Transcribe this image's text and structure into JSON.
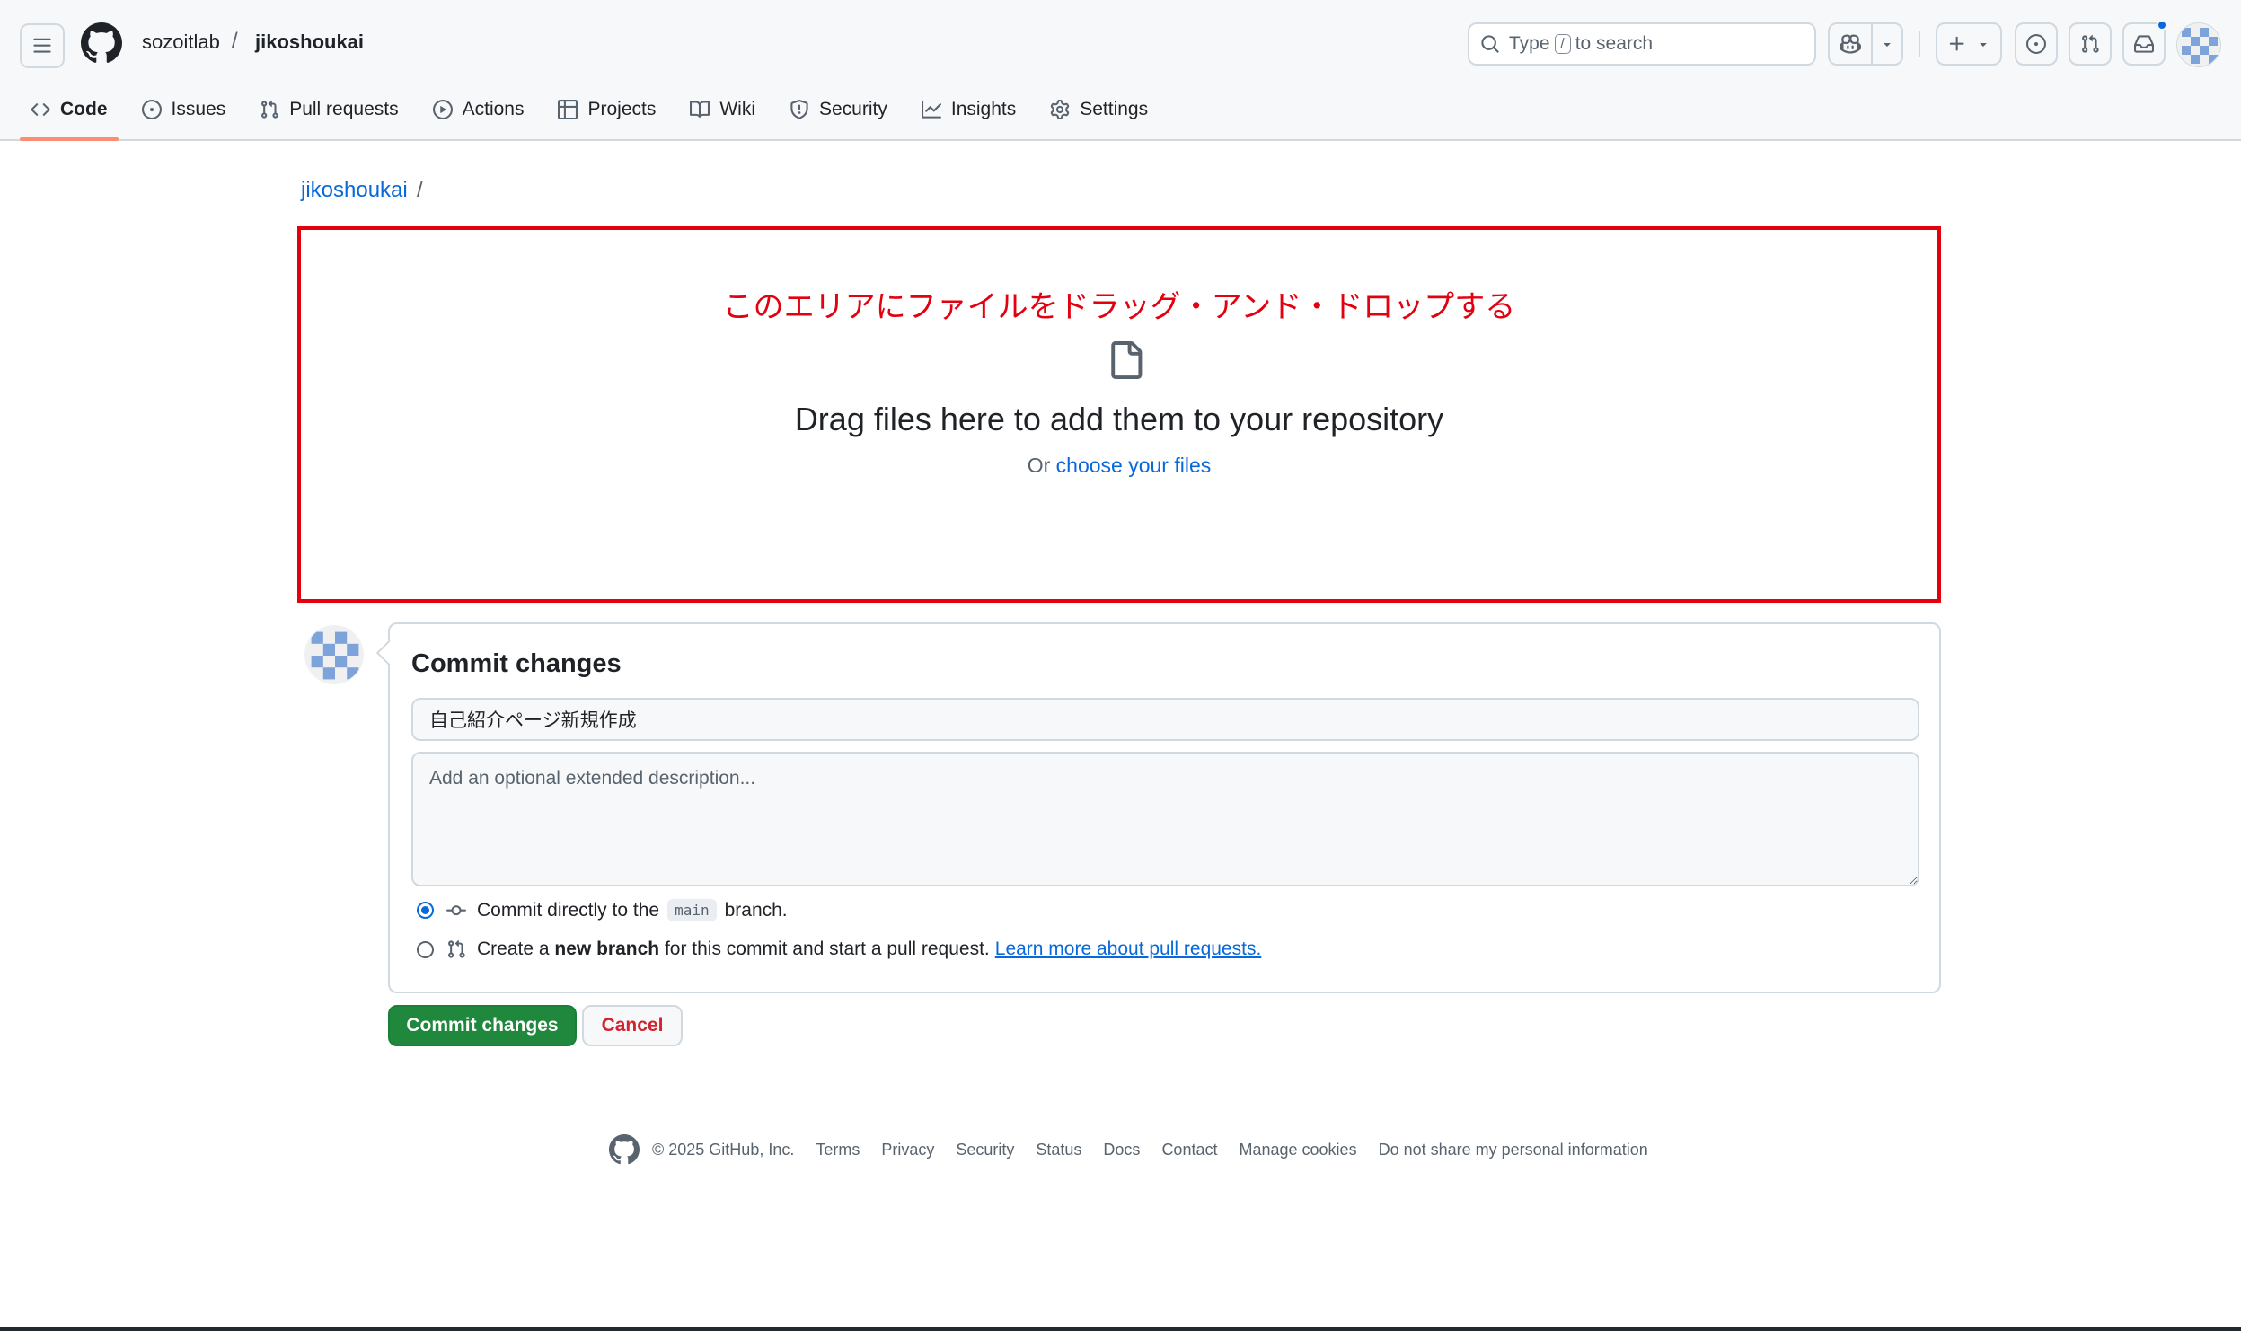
{
  "header": {
    "owner": "sozoitlab",
    "separator": "/",
    "repo": "jikoshoukai",
    "search": {
      "prefix": "Type",
      "key": "/",
      "suffix": "to search"
    }
  },
  "repo_nav": {
    "tabs": [
      {
        "label": "Code",
        "icon": "code-icon",
        "active": true
      },
      {
        "label": "Issues",
        "icon": "issue-opened-icon"
      },
      {
        "label": "Pull requests",
        "icon": "git-pull-request-icon"
      },
      {
        "label": "Actions",
        "icon": "play-icon"
      },
      {
        "label": "Projects",
        "icon": "table-icon"
      },
      {
        "label": "Wiki",
        "icon": "book-icon"
      },
      {
        "label": "Security",
        "icon": "shield-icon"
      },
      {
        "label": "Insights",
        "icon": "graph-icon"
      },
      {
        "label": "Settings",
        "icon": "gear-icon"
      }
    ]
  },
  "breadcrumb": {
    "repo": "jikoshoukai",
    "slash": "/"
  },
  "drop_zone": {
    "annotation": "このエリアにファイルをドラッグ・アンド・ドロップする",
    "annotation_color": "#e3000f",
    "title": "Drag files here to add them to your repository",
    "or": "Or",
    "choose_link": "choose your files"
  },
  "commit": {
    "heading": "Commit changes",
    "message_value": "自己紹介ページ新規作成",
    "description_placeholder": "Add an optional extended description...",
    "option_direct": {
      "before": "Commit directly to the",
      "branch": "main",
      "after": "branch.",
      "selected": true
    },
    "option_new_branch": {
      "before": "Create a",
      "bold": "new branch",
      "after": "for this commit and start a pull request.",
      "link": "Learn more about pull requests.",
      "selected": false
    },
    "submit_label": "Commit changes",
    "cancel_label": "Cancel",
    "colors": {
      "primary": "#1f883d",
      "danger": "#d1242f",
      "link": "#0969da"
    }
  },
  "footer": {
    "copyright": "© 2025 GitHub, Inc.",
    "links": [
      "Terms",
      "Privacy",
      "Security",
      "Status",
      "Docs",
      "Contact",
      "Manage cookies",
      "Do not share my personal information"
    ]
  }
}
